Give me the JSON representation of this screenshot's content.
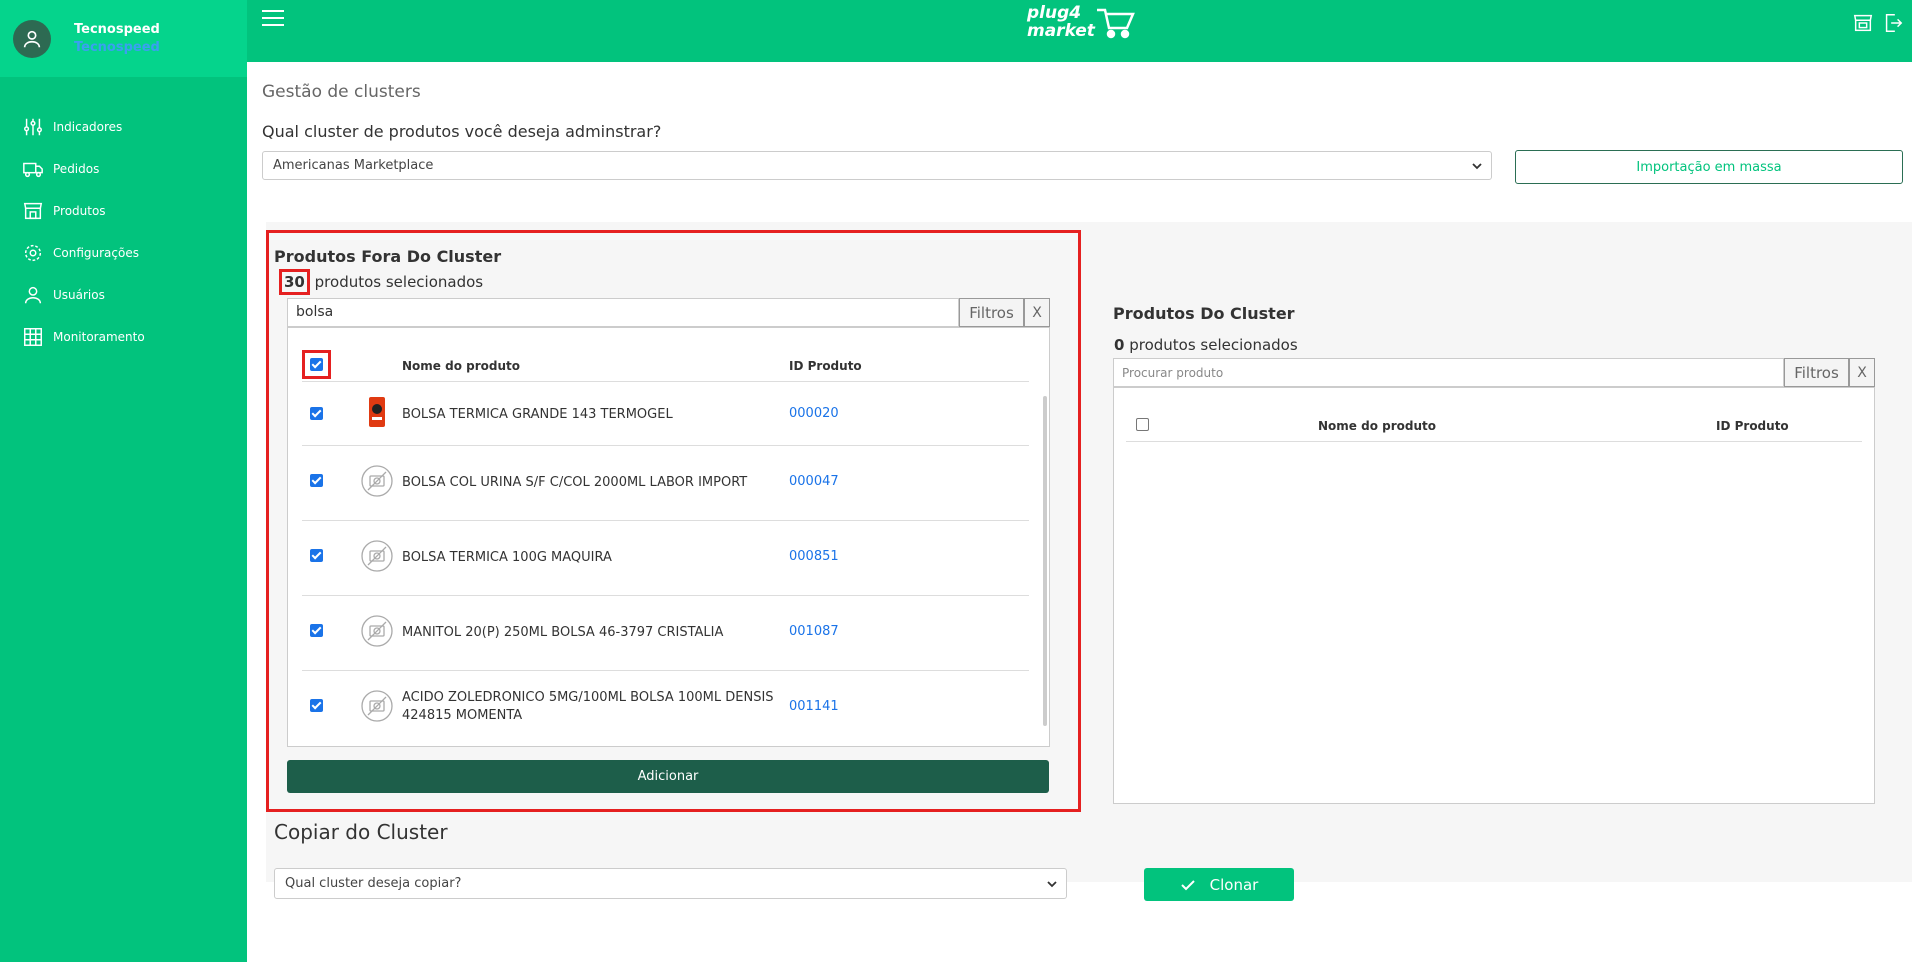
{
  "sidebar": {
    "user_name": "Tecnospeed",
    "company": "Tecnospeed",
    "items": [
      {
        "label": "Indicadores",
        "icon": "sliders-icon"
      },
      {
        "label": "Pedidos",
        "icon": "truck-icon"
      },
      {
        "label": "Produtos",
        "icon": "store-icon"
      },
      {
        "label": "Configurações",
        "icon": "gear-icon"
      },
      {
        "label": "Usuários",
        "icon": "user-icon"
      },
      {
        "label": "Monitoramento",
        "icon": "grid-icon"
      }
    ]
  },
  "header": {
    "logo_line1": "plug4",
    "logo_line2": "market"
  },
  "main": {
    "page_title": "Gestão de clusters",
    "question": "Qual cluster de produtos você deseja adminstrar?",
    "selected_cluster": "Americanas Marketplace",
    "mass_import_label": "Importação em massa"
  },
  "left_panel": {
    "title": "Produtos Fora Do Cluster",
    "selected_count": "30",
    "selected_suffix": "produtos selecionados",
    "search_value": "bolsa",
    "filter_label": "Filtros",
    "clear_label": "X",
    "col_name": "Nome do produto",
    "col_id": "ID Produto",
    "rows": [
      {
        "name": "BOLSA TERMICA GRANDE 143 TERMOGEL",
        "id": "000020",
        "checked": true,
        "thumb": "product-photo"
      },
      {
        "name": "BOLSA COL URINA S/F C/COL 2000ML LABOR IMPORT",
        "id": "000047",
        "checked": true,
        "thumb": "no-image-icon"
      },
      {
        "name": "BOLSA TERMICA 100G MAQUIRA",
        "id": "000851",
        "checked": true,
        "thumb": "no-image-icon"
      },
      {
        "name": "MANITOL 20(P) 250ML BOLSA 46-3797 CRISTALIA",
        "id": "001087",
        "checked": true,
        "thumb": "no-image-icon"
      },
      {
        "name": "ACIDO ZOLEDRONICO 5MG/100ML BOLSA 100ML DENSIS 424815 MOMENTA",
        "id": "001141",
        "checked": true,
        "thumb": "no-image-icon"
      }
    ],
    "add_label": "Adicionar"
  },
  "right_panel": {
    "title": "Produtos Do Cluster",
    "selected_count": "0",
    "selected_suffix": "produtos selecionados",
    "search_placeholder": "Procurar produto",
    "filter_label": "Filtros",
    "clear_label": "X",
    "col_name": "Nome do produto",
    "col_id": "ID Produto"
  },
  "copy": {
    "title": "Copiar do Cluster",
    "select_placeholder": "Qual cluster deseja copiar?",
    "clone_label": "Clonar"
  },
  "colors": {
    "brand_green": "#02c37d",
    "dark_green": "#1d5e4a",
    "highlight_red": "#e52020",
    "link_blue": "#1a73e8"
  }
}
